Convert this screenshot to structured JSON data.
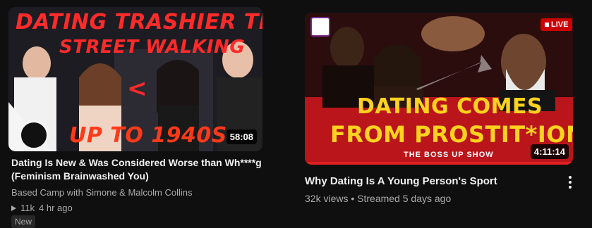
{
  "video1": {
    "thumbnail_text_top": "DATING TRASHIER THAN",
    "thumbnail_text_middle": "STREET WALKING",
    "thumbnail_text_bottom": "UP TO 1940S",
    "thumbnail_arrow": "<",
    "duration": "58:08",
    "title_line1": "Dating Is New & Was Considered Worse than Wh****g",
    "title_line2": "(Feminism Brainwashed You)",
    "channel": "Based Camp with Simone & Malcolm Collins",
    "views": "11k",
    "age": "4 hr ago",
    "badge": "New",
    "colors": {
      "thumb_text": "#ff2b2b",
      "thumb_bottom_text": "#ff3a1a"
    }
  },
  "video2": {
    "live_label": "LIVE",
    "thumbnail_text_line1": "DATING COMES",
    "thumbnail_text_line2": "FROM PROSTIT*ION",
    "thumbnail_brand": "THE BOSS UP SHOW",
    "duration": "4:11:14",
    "title": "Why Dating Is A Young Person's Sport",
    "meta": "32k views • Streamed 5 days ago",
    "colors": {
      "thumb_bg": "#c8171a",
      "thumb_text": "#ffd21f"
    }
  }
}
